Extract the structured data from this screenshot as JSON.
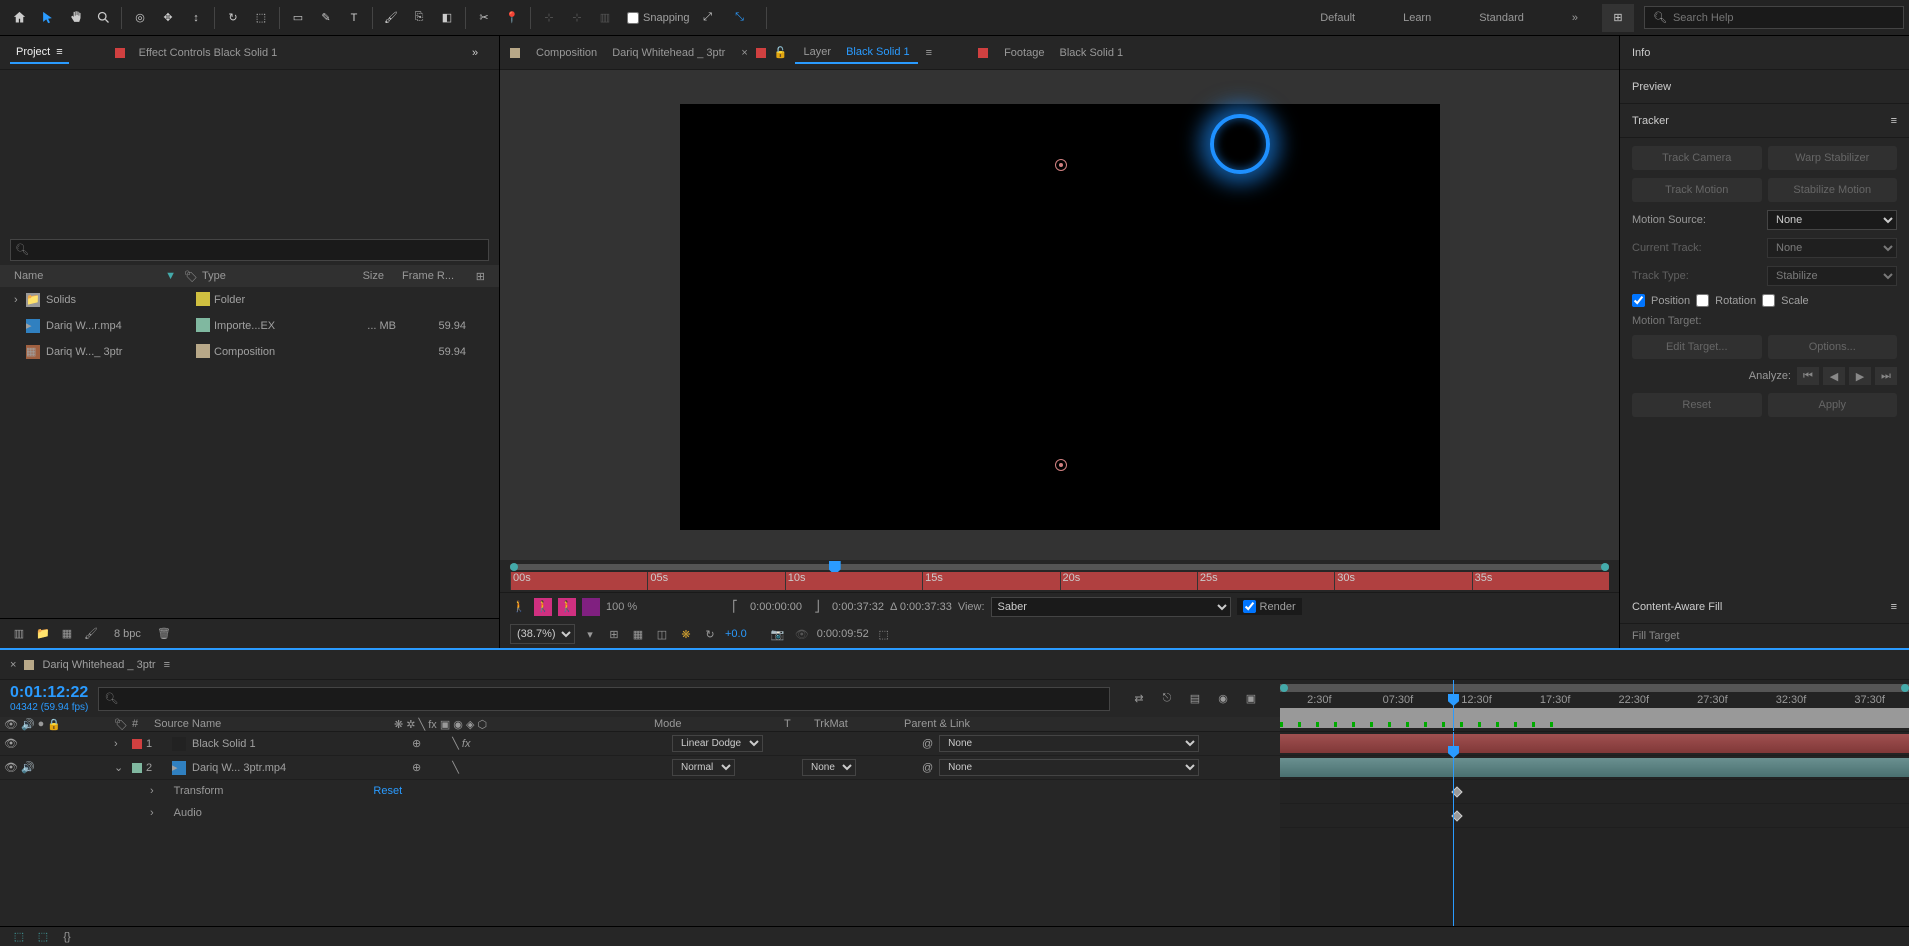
{
  "toolbar": {
    "snapping_label": "Snapping",
    "workspaces": [
      "Default",
      "Learn",
      "Standard"
    ],
    "search_placeholder": "Search Help"
  },
  "project_panel": {
    "tab_project": "Project",
    "tab_effects": "Effect Controls  Black Solid 1",
    "columns": {
      "name": "Name",
      "type": "Type",
      "size": "Size",
      "frame": "Frame R..."
    },
    "items": [
      {
        "name": "Solids",
        "type": "Folder",
        "size": "",
        "fr": ""
      },
      {
        "name": "Dariq W...r.mp4",
        "type": "Importe...EX",
        "size": "... MB",
        "fr": "59.94"
      },
      {
        "name": "Dariq W..._ 3ptr",
        "type": "Composition",
        "size": "",
        "fr": "59.94"
      }
    ],
    "bpc": "8 bpc"
  },
  "comp_tabs": {
    "composition_label": "Composition",
    "composition_name": "Dariq Whitehead _ 3ptr",
    "layer_label": "Layer",
    "layer_name": "Black Solid 1",
    "footage_label": "Footage",
    "footage_name": "Black Solid 1"
  },
  "mini_timeline_ticks": [
    "00s",
    "05s",
    "10s",
    "15s",
    "20s",
    "25s",
    "30s",
    "35s"
  ],
  "comp_bar": {
    "percent": "100 %",
    "t_in": "0:00:00:00",
    "t_out": "0:00:37:32",
    "t_dur": "Δ 0:00:37:33",
    "view_label": "View:",
    "view_opt": "Saber",
    "render": "Render",
    "zoom": "(38.7%)",
    "exp": "+0.0",
    "t_cur": "0:00:09:52"
  },
  "right": {
    "info": "Info",
    "preview": "Preview",
    "tracker": "Tracker",
    "caf": "Content-Aware Fill",
    "fill_target": "Fill Target",
    "track_camera": "Track Camera",
    "warp": "Warp Stabilizer",
    "track_motion": "Track Motion",
    "stabilize": "Stabilize Motion",
    "motion_source": "Motion Source:",
    "ms_val": "None",
    "current_track": "Current Track:",
    "ct_val": "None",
    "track_type": "Track Type:",
    "tt_val": "Stabilize",
    "position": "Position",
    "rotation": "Rotation",
    "scale": "Scale",
    "motion_target": "Motion Target:",
    "edit_target": "Edit Target...",
    "options": "Options...",
    "analyze": "Analyze:",
    "reset": "Reset",
    "apply": "Apply"
  },
  "timeline": {
    "tab": "Dariq Whitehead _ 3ptr",
    "timecode": "0:01:12:22",
    "sub": "04342 (59.94 fps)",
    "ruler": [
      "2:30f",
      "07:30f",
      "12:30f",
      "17:30f",
      "22:30f",
      "27:30f",
      "32:30f",
      "37:30f"
    ],
    "cols": {
      "num": "#",
      "source": "Source Name",
      "mode": "Mode",
      "t": "T",
      "trkmat": "TrkMat",
      "parent": "Parent & Link"
    },
    "layers": [
      {
        "num": "1",
        "name": "Black Solid 1",
        "mode": "Linear Dodge",
        "trk": "",
        "par": "None"
      },
      {
        "num": "2",
        "name": "Dariq W... 3ptr.mp4",
        "mode": "Normal",
        "trk": "None",
        "par": "None"
      }
    ],
    "transform": "Transform",
    "reset": "Reset",
    "audio": "Audio"
  }
}
